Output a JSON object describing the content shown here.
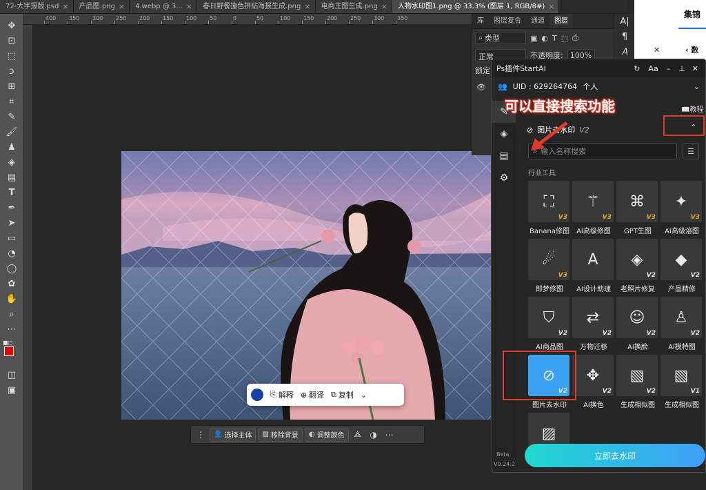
{
  "tabs": [
    {
      "label": "72-大字报版.psd"
    },
    {
      "label": "产品图.png"
    },
    {
      "label": "4.webp @ 3..."
    },
    {
      "label": "春日野餐撞色拼贴海报生成.png"
    },
    {
      "label": "电商主图生成.png"
    },
    {
      "label": "人物水印图1.png @ 33.3% (图层 1, RGB/8#)",
      "active": true
    }
  ],
  "ruler_ticks": [
    "400",
    "350",
    "300",
    "250",
    "200",
    "150",
    "100",
    "50",
    "0",
    "50",
    "100",
    "150",
    "200",
    "250",
    "300",
    "350"
  ],
  "ps_panel": {
    "tabs": [
      "库",
      "图层复合",
      "通道",
      "图层"
    ],
    "filter_label": "类型",
    "blend_mode": "正常",
    "opacity_label": "不透明度:",
    "opacity_value": "100%",
    "lock_label": "锁定"
  },
  "right_white": {
    "title": "集锦",
    "sub": "数"
  },
  "plugin": {
    "title": "Ps插件StartAI",
    "uid": "UID : 629264764",
    "account": "个人",
    "tutorial": "教程",
    "annotation": "可以直接搜索功能",
    "section_title": "图片去水印",
    "section_ver": "V2",
    "search_placeholder": "输入名称搜索",
    "group_label": "行业工具",
    "beta": "Beta",
    "version": "V0.24.2",
    "cta": "立即去水印",
    "tools": [
      {
        "label": "Banana修图",
        "ver": "V3",
        "icon": "image-edit-icon"
      },
      {
        "label": "AI高级修图",
        "ver": "V3",
        "icon": "magic-wand-icon"
      },
      {
        "label": "GPT生图",
        "ver": "V3",
        "icon": "knot-icon"
      },
      {
        "label": "AI高级溶图",
        "ver": "V3",
        "icon": "image-sparkle-icon"
      },
      {
        "label": "即梦修图",
        "ver": "V3",
        "icon": "dream-icon"
      },
      {
        "label": "AI设计助理",
        "ver": "",
        "icon": "letter-a-icon"
      },
      {
        "label": "老照片修复",
        "ver": "V2",
        "icon": "eraser-icon"
      },
      {
        "label": "产品精修",
        "ver": "V2",
        "icon": "gem-icon"
      },
      {
        "label": "AI商品图",
        "ver": "V2",
        "icon": "bag-icon"
      },
      {
        "label": "万物迁移",
        "ver": "V2",
        "icon": "transfer-icon"
      },
      {
        "label": "AI换脸",
        "ver": "V2",
        "icon": "face-icon"
      },
      {
        "label": "AI模特图",
        "ver": "V2",
        "icon": "model-icon"
      },
      {
        "label": "图片去水印",
        "ver": "V2",
        "icon": "no-watermark-icon",
        "selected": true
      },
      {
        "label": "AI换色",
        "ver": "V2",
        "icon": "palette-icon"
      },
      {
        "label": "生成相似图",
        "ver": "V2",
        "icon": "similar-image-icon"
      },
      {
        "label": "生成相似图",
        "ver": "V1",
        "icon": "similar-image-icon"
      },
      {
        "label": "",
        "ver": "",
        "icon": "stripes-icon"
      }
    ]
  },
  "context_bar": {
    "select_subject": "选择主体",
    "remove_bg": "移除背景",
    "adjust_color": "调整颜色"
  },
  "float_bar": {
    "explain": "解释",
    "translate": "翻译",
    "copy": "复制"
  },
  "colors": {
    "accent": "#3fa0f8",
    "annotation_red": "#e23a2a",
    "version_gold": "#e0a820"
  }
}
